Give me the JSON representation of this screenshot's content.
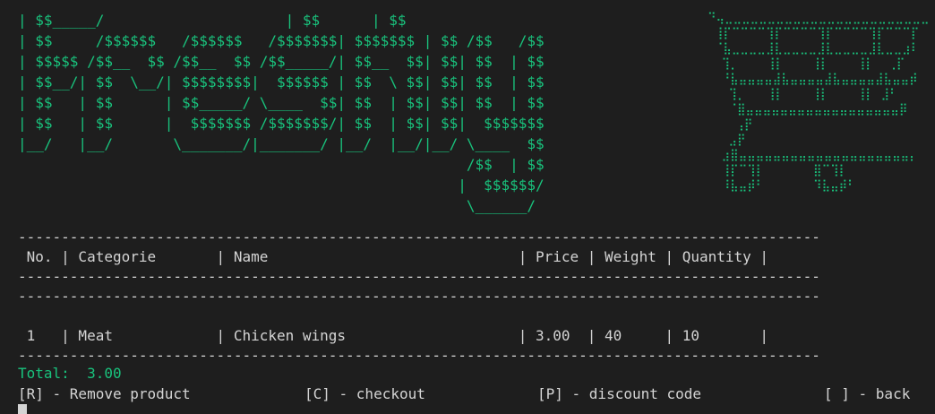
{
  "colors": {
    "background": "#1e1e1e",
    "text": "#d4d4d4",
    "accent_green": "#19c37d"
  },
  "ascii": {
    "logo": "| $$_____/                     | $$      | $$\n| $$     /$$$$$$   /$$$$$$   /$$$$$$$| $$$$$$$ | $$ /$$   /$$\n| $$$$$ /$$__  $$ /$$__  $$ /$$_____/| $$__  $$| $$| $$  | $$\n| $$__/| $$  \\__/| $$$$$$$$|  $$$$$$ | $$  \\ $$| $$| $$  | $$\n| $$   | $$      | $$_____/ \\____  $$| $$  | $$| $$| $$  | $$\n| $$   | $$      |  $$$$$$$ /$$$$$$$/| $$  | $$| $$|  $$$$$$$\n|__/   |__/       \\_______/|_______/ |__/  |__/|__/ \\____  $$\n                                                    /$$  | $$\n                                                   |  $$$$$$/\n                                                    \\______/",
    "cart": "⠙⢤⣀⣀⣀⣀⣀⣀⣀⣀⣀⣀⣀⣀⣀⣀⣀⣀⣀⣀⣀⣀⣀⣀⣀⣀\n ⢸⡏⠉⠉⠉⠉⢹⡏⠉⠉⠉⠉⢹⡏⠉⠉⠉⠉⢹⡏⠉⠉⠉⡏\n ⠈⣧⣀⣀⣀⣀⣸⣇⣀⣀⣀⣀⣸⣇⣀⣀⣀⣀⣸⣇⣀⣀⣰⠇\n  ⢹⡀    ⢸⡇    ⢸⡇    ⢸⡇  ⢀⡏\n  ⠘⣧⣤⣤⣤⣤⣼⣧⣤⣤⣤⣤⣼⣧⣤⣤⣤⣤⣼⣧⣤⣤⡾\n   ⢹⡀   ⢸⡇    ⢸⡇    ⢸⡇ ⣸⠃\n   ⠈⣿⣤⣤⣤⣤⣤⣤⣤⣤⣤⣤⣤⣤⣤⣤⣤⣤⣤⣤⡿\n    ⢠⡟\n   ⣠⡟\n  ⣰⣿⣤⣤⣤⣤⣤⣤⣤⣤⣤⣤⣤⣤⣤⣤⣤⣤⣤⣤⣤⣤⡄\n  ⢸⡏⠉⢹⡇       ⣿⠉⢹⡇\n  ⠸⣧⣤⡾⠃       ⠹⣧⣤⡾⠃"
  },
  "table": {
    "separator": "---------------------------------------------------------------------------------------------",
    "header_line": " No. | Categorie       | Name                             | Price | Weight | Quantity |",
    "rows": [
      " 1   | Meat            | Chicken wings                    | 3.00  | 40     | 10       |"
    ]
  },
  "summary": {
    "total_line": "Total:  3.00"
  },
  "menu": {
    "remove": "[R] - Remove product",
    "checkout": "[C] - checkout",
    "discount": "[P] - discount code",
    "back": "[ ] - back"
  }
}
